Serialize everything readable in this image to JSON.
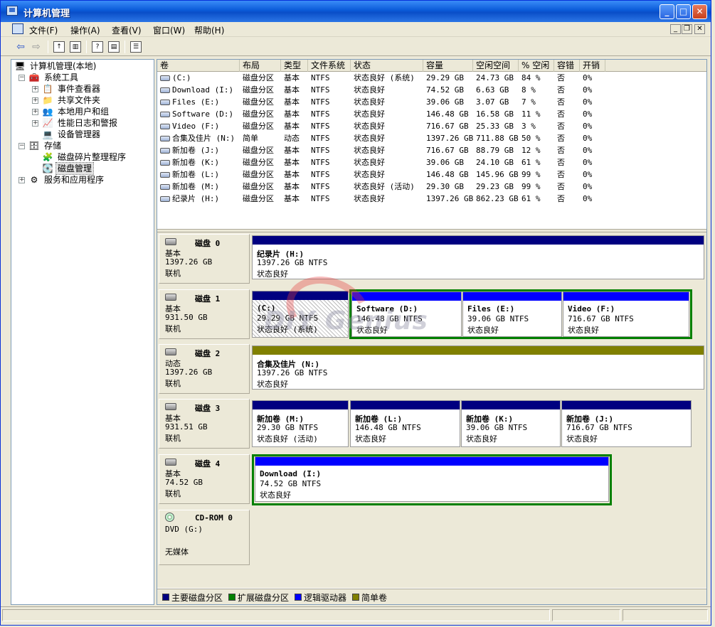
{
  "window": {
    "title": "计算机管理"
  },
  "menu": [
    {
      "label": "文件(F)"
    },
    {
      "label": "操作(A)"
    },
    {
      "label": "查看(V)"
    },
    {
      "label": "窗口(W)"
    },
    {
      "label": "帮助(H)"
    }
  ],
  "tree": {
    "root": "计算机管理(本地)",
    "items": [
      {
        "label": "系统工具",
        "level": 1,
        "expander": "-",
        "icon": "toolbox-icon"
      },
      {
        "label": "事件查看器",
        "level": 2,
        "expander": "+",
        "icon": "event-viewer-icon"
      },
      {
        "label": "共享文件夹",
        "level": 2,
        "expander": "+",
        "icon": "shared-folder-icon"
      },
      {
        "label": "本地用户和组",
        "level": 2,
        "expander": "+",
        "icon": "users-icon"
      },
      {
        "label": "性能日志和警报",
        "level": 2,
        "expander": "+",
        "icon": "performance-icon"
      },
      {
        "label": "设备管理器",
        "level": 2,
        "expander": "",
        "icon": "device-manager-icon"
      },
      {
        "label": "存储",
        "level": 1,
        "expander": "-",
        "icon": "storage-icon"
      },
      {
        "label": "磁盘碎片整理程序",
        "level": 2,
        "expander": "",
        "icon": "defrag-icon"
      },
      {
        "label": "磁盘管理",
        "level": 2,
        "expander": "",
        "icon": "disk-management-icon",
        "selected": true
      },
      {
        "label": "服务和应用程序",
        "level": 1,
        "expander": "+",
        "icon": "services-icon"
      }
    ]
  },
  "volume_list": {
    "columns": [
      "卷",
      "布局",
      "类型",
      "文件系统",
      "状态",
      "容量",
      "空闲空间",
      "% 空闲",
      "容错",
      "开销"
    ],
    "rows": [
      [
        "(C:)",
        "磁盘分区",
        "基本",
        "NTFS",
        "状态良好 (系统)",
        "29.29 GB",
        "24.73 GB",
        "84 %",
        "否",
        "0%"
      ],
      [
        "Download (I:)",
        "磁盘分区",
        "基本",
        "NTFS",
        "状态良好",
        "74.52 GB",
        "6.63 GB",
        "8 %",
        "否",
        "0%"
      ],
      [
        "Files (E:)",
        "磁盘分区",
        "基本",
        "NTFS",
        "状态良好",
        "39.06 GB",
        "3.07 GB",
        "7 %",
        "否",
        "0%"
      ],
      [
        "Software (D:)",
        "磁盘分区",
        "基本",
        "NTFS",
        "状态良好",
        "146.48 GB",
        "16.58 GB",
        "11 %",
        "否",
        "0%"
      ],
      [
        "Video (F:)",
        "磁盘分区",
        "基本",
        "NTFS",
        "状态良好",
        "716.67 GB",
        "25.33 GB",
        "3 %",
        "否",
        "0%"
      ],
      [
        "合集及佳片 (N:)",
        "简单",
        "动态",
        "NTFS",
        "状态良好",
        "1397.26 GB",
        "711.88 GB",
        "50 %",
        "否",
        "0%"
      ],
      [
        "新加卷 (J:)",
        "磁盘分区",
        "基本",
        "NTFS",
        "状态良好",
        "716.67 GB",
        "88.79 GB",
        "12 %",
        "否",
        "0%"
      ],
      [
        "新加卷 (K:)",
        "磁盘分区",
        "基本",
        "NTFS",
        "状态良好",
        "39.06 GB",
        "24.10 GB",
        "61 %",
        "否",
        "0%"
      ],
      [
        "新加卷 (L:)",
        "磁盘分区",
        "基本",
        "NTFS",
        "状态良好",
        "146.48 GB",
        "145.96 GB",
        "99 %",
        "否",
        "0%"
      ],
      [
        "新加卷 (M:)",
        "磁盘分区",
        "基本",
        "NTFS",
        "状态良好 (活动)",
        "29.30 GB",
        "29.23 GB",
        "99 %",
        "否",
        "0%"
      ],
      [
        "纪录片 (H:)",
        "磁盘分区",
        "基本",
        "NTFS",
        "状态良好",
        "1397.26 GB",
        "862.23 GB",
        "61 %",
        "否",
        "0%"
      ]
    ]
  },
  "disks": [
    {
      "name": "磁盘 0",
      "type": "基本",
      "size": "1397.26 GB",
      "status": "联机",
      "parts": [
        {
          "name": "纪录片 (H:)",
          "size": "1397.26 GB NTFS",
          "status": "状态良好"
        }
      ]
    },
    {
      "name": "磁盘 1",
      "type": "基本",
      "size": "931.50 GB",
      "status": "联机",
      "parts": [
        {
          "name": "(C:)",
          "size": "29.29 GB NTFS",
          "status": "状态良好 (系统)"
        },
        {
          "name": "Software (D:)",
          "size": "146.48 GB NTFS",
          "status": "状态良好"
        },
        {
          "name": "Files (E:)",
          "size": "39.06 GB NTFS",
          "status": "状态良好"
        },
        {
          "name": "Video (F:)",
          "size": "716.67 GB NTFS",
          "status": "状态良好"
        }
      ]
    },
    {
      "name": "磁盘 2",
      "type": "动态",
      "size": "1397.26 GB",
      "status": "联机",
      "parts": [
        {
          "name": "合集及佳片 (N:)",
          "size": "1397.26 GB NTFS",
          "status": "状态良好"
        }
      ]
    },
    {
      "name": "磁盘 3",
      "type": "基本",
      "size": "931.51 GB",
      "status": "联机",
      "parts": [
        {
          "name": "新加卷 (M:)",
          "size": "29.30 GB NTFS",
          "status": "状态良好 (活动)"
        },
        {
          "name": "新加卷 (L:)",
          "size": "146.48 GB NTFS",
          "status": "状态良好"
        },
        {
          "name": "新加卷 (K:)",
          "size": "39.06 GB NTFS",
          "status": "状态良好"
        },
        {
          "name": "新加卷 (J:)",
          "size": "716.67 GB NTFS",
          "status": "状态良好"
        }
      ]
    },
    {
      "name": "磁盘 4",
      "type": "基本",
      "size": "74.52 GB",
      "status": "联机",
      "parts": [
        {
          "name": "Download (I:)",
          "size": "74.52 GB NTFS",
          "status": "状态良好"
        }
      ]
    },
    {
      "name": "CD-ROM 0",
      "type": "DVD (G:)",
      "size": "",
      "status": "无媒体",
      "parts": []
    }
  ],
  "legend": [
    {
      "label": "主要磁盘分区",
      "color": "#000080"
    },
    {
      "label": "扩展磁盘分区",
      "color": "#008000"
    },
    {
      "label": "逻辑驱动器",
      "color": "#0000ff"
    },
    {
      "label": "简单卷",
      "color": "#808000"
    }
  ],
  "colors": {
    "primary": "#000080",
    "extended": "#008000",
    "logical": "#0000ff",
    "simple": "#808000"
  }
}
